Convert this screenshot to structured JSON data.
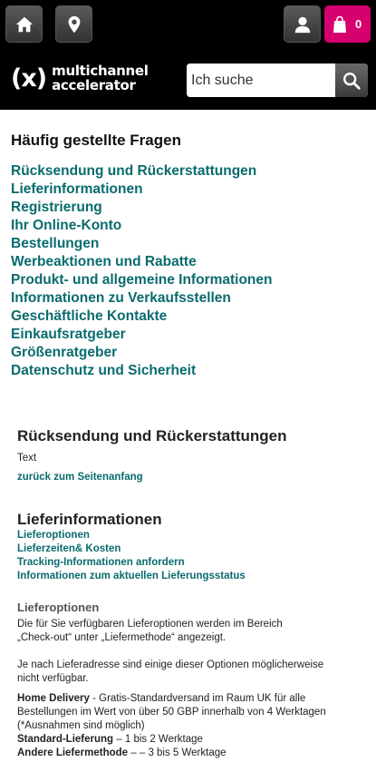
{
  "header": {
    "cart_count": "0",
    "logo_mark": "(x)",
    "logo_line1": "multichannel",
    "logo_line2": "accelerator",
    "search_placeholder": "Ich suche",
    "icons": {
      "home": "home-icon",
      "location": "location-pin-icon",
      "user": "user-icon",
      "cart": "shopping-bag-icon",
      "search": "search-icon"
    },
    "colors": {
      "bar": "#000000",
      "cart": "#d6006f",
      "link": "#0a6b6e"
    }
  },
  "faq": {
    "title": "Häufig gestellte Fragen",
    "links": [
      "Rücksendung und Rückerstattungen",
      "Lieferinformationen",
      "Registrierung",
      "Ihr Online-Konto",
      "Bestellungen",
      "Werbeaktionen und Rabatte",
      "Produkt- und allgemeine Informationen",
      "Informationen zu Verkaufsstellen",
      "Geschäftliche Kontakte",
      "Einkaufsratgeber",
      "Größenratgeber",
      "Datenschutz und Sicherheit"
    ]
  },
  "returns": {
    "heading": "Rücksendung und Rückerstattungen",
    "text": "Text",
    "back_to_top": "zurück zum Seitenanfang"
  },
  "delivery": {
    "heading": "Lieferinformationen",
    "links": [
      "Lieferoptionen",
      "Lieferzeiten& Kosten",
      "Tracking-Informationen anfordern",
      "Informationen zum aktuellen Lieferungsstatus"
    ],
    "options_heading": "Lieferoptionen",
    "para1_line1": "Die für Sie verfügbaren Lieferoptionen werden im Bereich",
    "para1_line2": "„Check-out“ unter „Liefermethode“ angezeigt.",
    "para2_line1": "Je nach Lieferadresse sind einige dieser Optionen möglicherweise",
    "para2_line2": "nicht verfügbar.",
    "home_label": "Home Delivery",
    "home_line1": " - Gratis-Standardversand im Raum UK für alle",
    "home_line2": "Bestellungen im Wert von über 50 GBP innerhalb von 4 Werktagen",
    "home_line3": "(*Ausnahmen sind möglich)",
    "standard_label": "Standard-Lieferung",
    "standard_text": " – 1 bis 2 Werktage",
    "other_label": "Andere Liefermethode",
    "other_text": " – – 3 bis 5 Werktage"
  }
}
